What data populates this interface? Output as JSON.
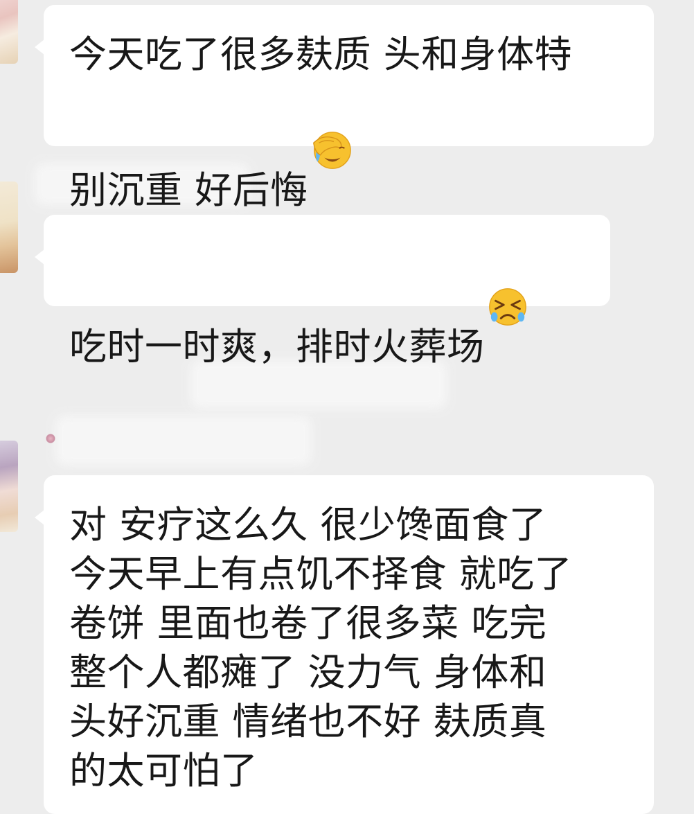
{
  "chat": {
    "messages": [
      {
        "text": "今天吃了很多麸质 头和身体特\n别沉重   好后悔",
        "emoji": "facepalm-crying-emoji"
      },
      {
        "text": "吃时一时爽，排时火葬场",
        "emoji": "squinting-crying-emoji"
      },
      {
        "text": "对 安疗这么久 很少馋面食了\n今天早上有点饥不择食 就吃了\n卷饼 里面也卷了很多菜 吃完\n整个人都瘫了 没力气 身体和\n头好沉重  情绪也不好 麸质真\n的太可怕了",
        "emoji": ""
      }
    ]
  },
  "colors": {
    "background": "#ededed",
    "bubble": "#ffffff",
    "text": "#181818",
    "emoji_yellow": "#f7c12e"
  }
}
